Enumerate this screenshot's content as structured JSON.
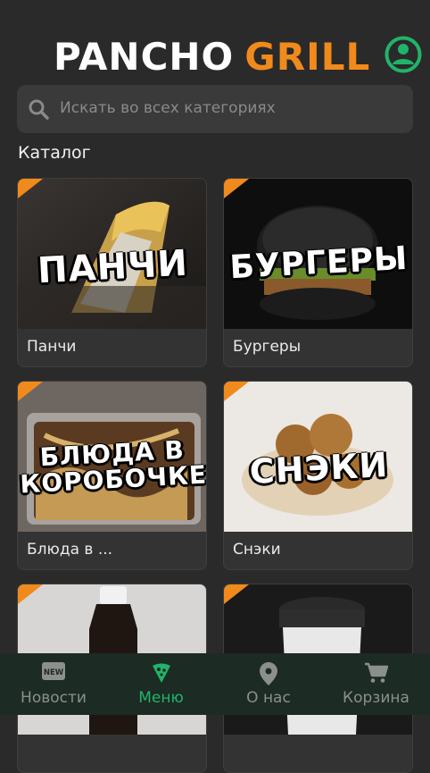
{
  "header": {
    "logo_left": "PANCHO",
    "logo_right": "GRILL"
  },
  "search": {
    "placeholder": "Искать во всех категориях"
  },
  "catalog": {
    "title": "Каталог",
    "cards": [
      {
        "overlay": "ПАНЧИ",
        "label": "Панчи"
      },
      {
        "overlay": "БУРГЕРЫ",
        "label": "Бургеры"
      },
      {
        "overlay_line1": "БЛЮДА В",
        "overlay_line2": "КОРОБОЧКЕ",
        "label": "Блюда в ..."
      },
      {
        "overlay": "СНЭКИ",
        "label": "Снэки"
      }
    ]
  },
  "nav": {
    "items": [
      {
        "label": "Новости",
        "icon_text": "NEW"
      },
      {
        "label": "Меню"
      },
      {
        "label": "О нас"
      },
      {
        "label": "Корзина"
      }
    ],
    "active_index": 1
  },
  "colors": {
    "background": "#2a2a2a",
    "accent_orange": "#f08a1c",
    "accent_green": "#21b36a",
    "nav_bg": "#1c2b24"
  }
}
